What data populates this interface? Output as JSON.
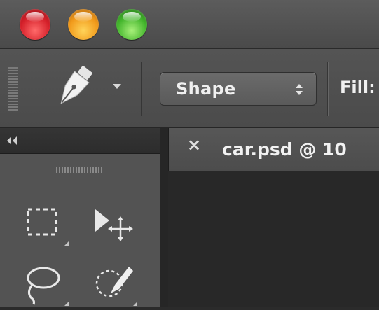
{
  "options_bar": {
    "mode_value": "Shape",
    "fill_label": "Fill:"
  },
  "document_tab": {
    "close_glyph": "×",
    "title": "car.psd @ 10"
  },
  "colors": {
    "close_button": "#d5202a",
    "minimize_button": "#f19a1b",
    "zoom_button": "#43b52c",
    "toolbar_bg": "#4b4b4b",
    "panel_bg": "#535353",
    "canvas_bg": "#282828"
  },
  "icons": {
    "tool": "pen-icon",
    "tools_panel": [
      "rectangular-marquee-icon",
      "path-selection-icon",
      "lasso-icon",
      "quick-selection-icon"
    ]
  }
}
